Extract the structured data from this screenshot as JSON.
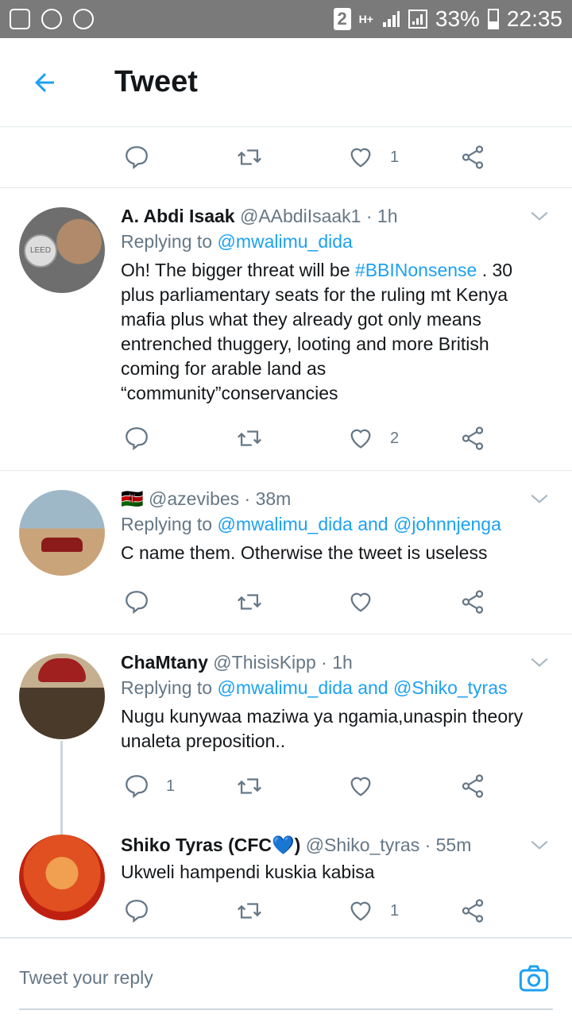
{
  "status_bar": {
    "sim": "2",
    "net": "H+",
    "battery": "33%",
    "time": "22:35"
  },
  "header": {
    "title": "Tweet"
  },
  "top_actions": {
    "like_count": "1"
  },
  "tweets": [
    {
      "name": "A. Abdi Isaak",
      "handle": "@AAbdiIsaak1",
      "time": "· 1h",
      "reply_prefix": "Replying to",
      "reply_to": "@mwalimu_dida",
      "text_a": "Oh! The bigger threat will be ",
      "hashtag": "#BBINonsense",
      "text_b": " . 30 plus parliamentary seats for the ruling mt Kenya mafia plus what they already got only means entrenched thuggery, looting and more British coming for arable land as “community”conservancies",
      "reply_count": "",
      "like_count": "2"
    },
    {
      "name": "🇰🇪",
      "handle": "@azevibes",
      "time": "· 38m",
      "reply_prefix": "Replying to",
      "reply_to": "@mwalimu_dida and @johnnjenga",
      "text": "C name them. Otherwise the tweet is useless",
      "reply_count": "",
      "like_count": ""
    },
    {
      "name": "ChaMtany",
      "handle": "@ThisisKipp",
      "time": "· 1h",
      "reply_prefix": "Replying to",
      "reply_to": "@mwalimu_dida and @Shiko_tyras",
      "text": "Nugu kunywaa maziwa ya ngamia,unaspin theory unaleta preposition..",
      "reply_count": "1",
      "like_count": ""
    },
    {
      "name": "Shiko Tyras (CFC💙)",
      "handle": "@Shiko_tyras",
      "time": "· 55m",
      "text": "Ukweli hampendi kuskia kabisa",
      "reply_count": "",
      "like_count": "1"
    }
  ],
  "reply_bar": {
    "placeholder": "Tweet your reply"
  },
  "colors": {
    "accent": "#1da1f2",
    "muted": "#657786",
    "text": "#14171a",
    "divider": "#e1e8ed"
  },
  "icons": [
    "back-arrow-icon",
    "reply-icon",
    "retweet-icon",
    "heart-icon",
    "share-icon",
    "chevron-down-icon",
    "camera-icon"
  ]
}
